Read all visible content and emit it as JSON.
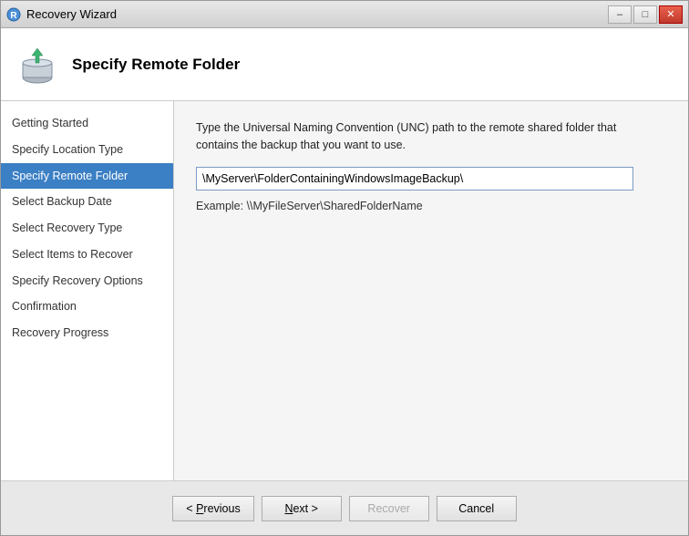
{
  "window": {
    "title": "Recovery Wizard",
    "icon": "wizard-icon"
  },
  "titlebar": {
    "minimize_label": "–",
    "maximize_label": "□",
    "close_label": "✕"
  },
  "header": {
    "title": "Specify Remote Folder",
    "icon": "folder-upload-icon"
  },
  "sidebar": {
    "items": [
      {
        "label": "Getting Started",
        "active": false
      },
      {
        "label": "Specify Location Type",
        "active": false
      },
      {
        "label": "Specify Remote Folder",
        "active": true
      },
      {
        "label": "Select Backup Date",
        "active": false
      },
      {
        "label": "Select Recovery Type",
        "active": false
      },
      {
        "label": "Select Items to Recover",
        "active": false
      },
      {
        "label": "Specify Recovery Options",
        "active": false
      },
      {
        "label": "Confirmation",
        "active": false
      },
      {
        "label": "Recovery Progress",
        "active": false
      }
    ]
  },
  "content": {
    "description": "Type the Universal Naming Convention (UNC) path to the remote shared folder that contains the backup that you want to use.",
    "input_value": "\\MyServer\\FolderContainingWindowsImageBackup\\",
    "input_placeholder": "",
    "example_label": "Example: \\\\MyFileServer\\SharedFolderName"
  },
  "footer": {
    "previous_label": "< Previous",
    "next_label": "Next >",
    "recover_label": "Recover",
    "cancel_label": "Cancel"
  }
}
